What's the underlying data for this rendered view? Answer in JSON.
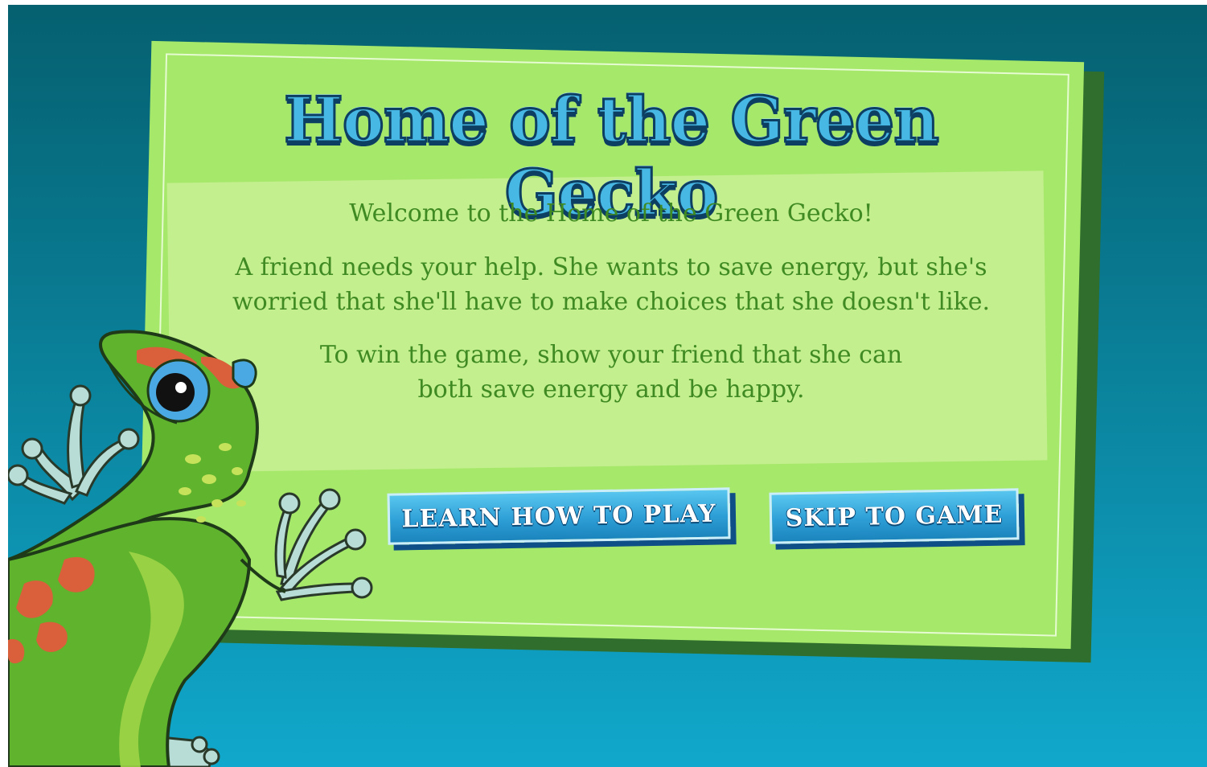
{
  "game": {
    "title": "Home of the Green Gecko"
  },
  "intro": {
    "welcome": "Welcome to the Home of the Green Gecko!",
    "story_line1": "A friend needs your help.  She wants to save energy, but she's",
    "story_line2": "worried that she'll have to make choices that she doesn't like.",
    "goal_line1": "To win the game, show your friend that she can",
    "goal_line2": "both save energy and be happy."
  },
  "buttons": {
    "learn_label": "LEARN HOW TO PLAY",
    "skip_label": "SKIP TO GAME"
  },
  "colors": {
    "background_top": "#05606f",
    "background_bottom": "#10a8cc",
    "panel": "#a6e86a",
    "text": "#3f8a22",
    "title": "#47b7e3",
    "button": "#2e9fd6"
  },
  "icons": {
    "mascot": "green-gecko-illustration"
  }
}
